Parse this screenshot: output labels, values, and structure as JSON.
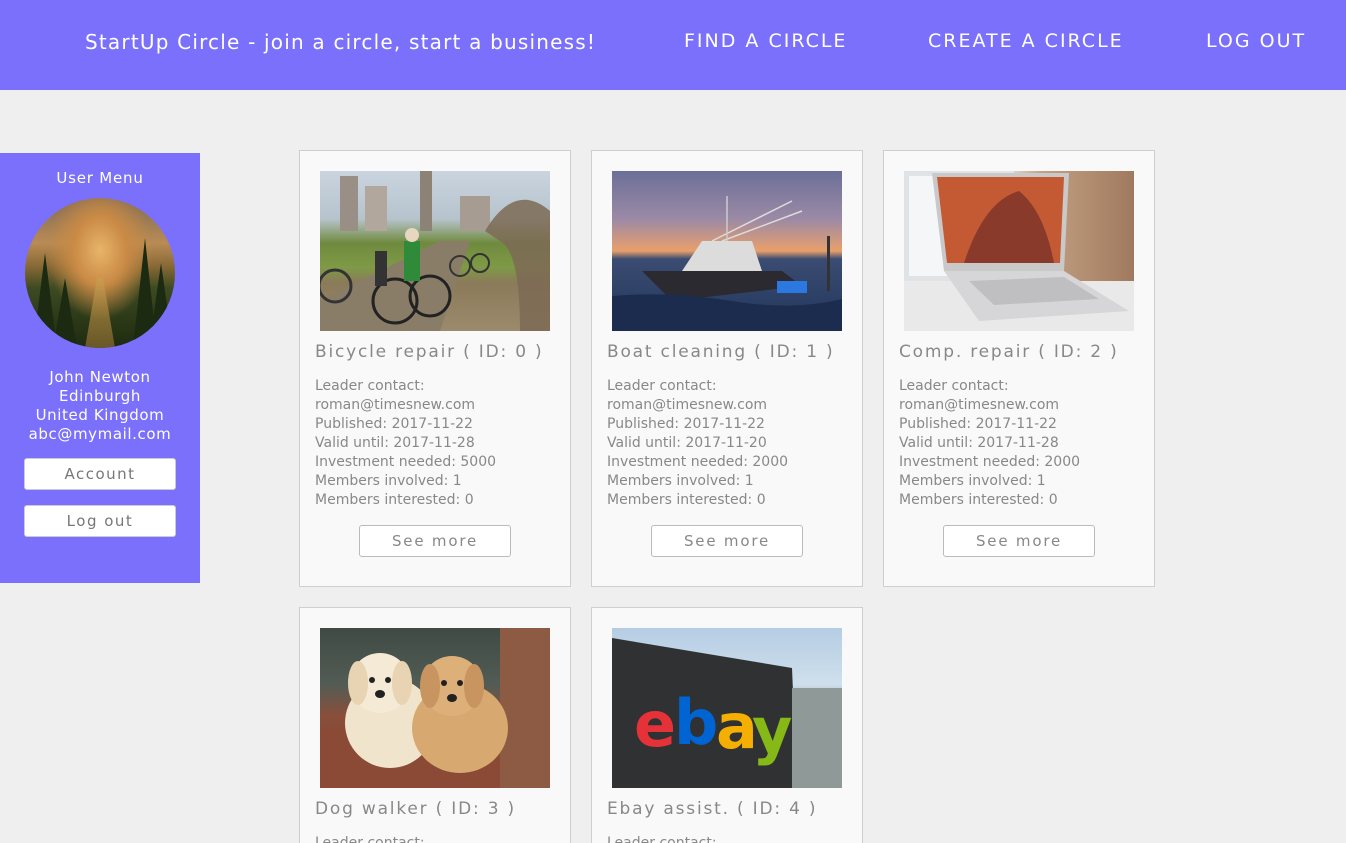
{
  "header": {
    "brand": "StartUp Circle - join a circle, start a business!",
    "nav": {
      "find": "FIND A CIRCLE",
      "create": "CREATE A CIRCLE",
      "logout": "LOG OUT"
    }
  },
  "user_menu": {
    "title": "User Menu",
    "name": "John Newton",
    "city": "Edinburgh",
    "country": "United Kingdom",
    "email": "abc@mymail.com",
    "account_button": "Account",
    "logout_button": "Log out"
  },
  "circles": [
    {
      "title": "Bicycle repair ( ID: 0 )",
      "leader_label": "Leader contact:",
      "leader_email": "roman@timesnew.com",
      "published": "Published: 2017-11-22",
      "valid_until": "Valid until: 2017-11-28",
      "investment": "Investment needed: 5000",
      "members_involved": "Members involved: 1",
      "members_interested": "Members interested: 0",
      "button": "See more",
      "image": "cyclists-photo"
    },
    {
      "title": "Boat cleaning ( ID: 1 )",
      "leader_label": "Leader contact:",
      "leader_email": "roman@timesnew.com",
      "published": "Published: 2017-11-22",
      "valid_until": "Valid until: 2017-11-20",
      "investment": "Investment needed: 2000",
      "members_involved": "Members involved: 1",
      "members_interested": "Members interested: 0",
      "button": "See more",
      "image": "boat-photo"
    },
    {
      "title": "Comp. repair ( ID: 2 )",
      "leader_label": "Leader contact:",
      "leader_email": "roman@timesnew.com",
      "published": "Published: 2017-11-22",
      "valid_until": "Valid until: 2017-11-28",
      "investment": "Investment needed: 2000",
      "members_involved": "Members involved: 1",
      "members_interested": "Members interested: 0",
      "button": "See more",
      "image": "laptop-photo"
    },
    {
      "title": "Dog walker ( ID: 3 )",
      "leader_label": "Leader contact:",
      "image": "puppies-photo"
    },
    {
      "title": "Ebay assist. ( ID: 4 )",
      "leader_label": "Leader contact:",
      "image": "ebay-sign-photo",
      "logo_letters": [
        "e",
        "b",
        "a",
        "y"
      ]
    }
  ],
  "colors": {
    "accent": "#7b70fb",
    "background": "#efefef",
    "card": "#f9f9f9",
    "text_muted": "#888888"
  }
}
